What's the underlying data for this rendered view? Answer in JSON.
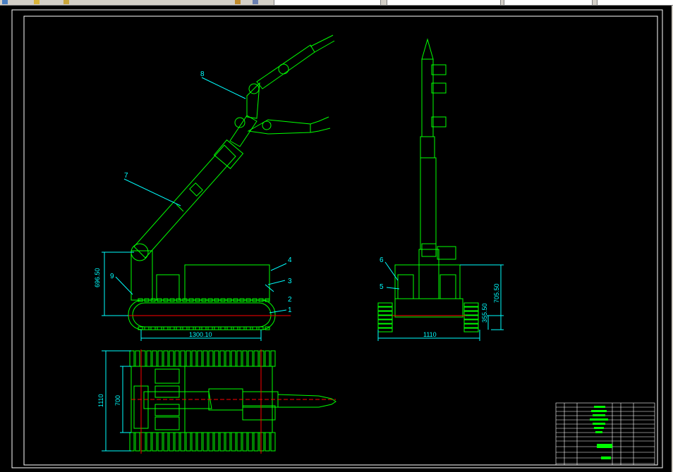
{
  "window": {
    "tabs": [
      {
        "label": ""
      },
      {
        "label": ""
      },
      {
        "label": ""
      },
      {
        "label": ""
      }
    ]
  },
  "toolbar_icons": [
    "cube-icon",
    "open-folder-icon",
    "save-icon",
    "tool-icon",
    "pan-icon",
    "layers-icon"
  ],
  "colors": {
    "background": "#000000",
    "frame": "#ffffff",
    "geometry": "#00ff00",
    "dimension": "#00ffff",
    "centerline": "#ff0000",
    "chrome": "#d4d0c8"
  },
  "drawing": {
    "side_view": {
      "dimensions": {
        "height_label": "696.50",
        "length_label": "1300.10"
      },
      "callouts": [
        "1",
        "2",
        "3",
        "4",
        "7",
        "8",
        "9"
      ]
    },
    "front_view": {
      "dimensions": {
        "height_total": "705.50",
        "height_partial": "355.50",
        "width_label": "1110"
      },
      "callouts": [
        "5",
        "6"
      ]
    },
    "top_view": {
      "dimensions": {
        "width_outer": "1110",
        "width_inner": "700"
      }
    }
  }
}
